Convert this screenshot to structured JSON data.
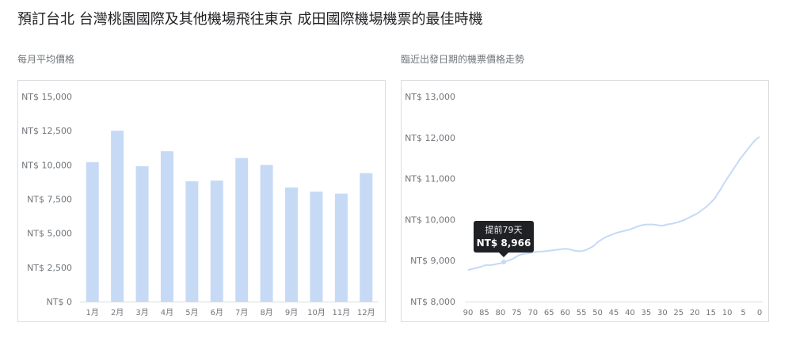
{
  "page": {
    "title": "預訂台北 台灣桃園國際及其他機場飛往東京 成田國際機場機票的最佳時機"
  },
  "colors": {
    "bar": "#c6daf6",
    "line": "#c6daf6",
    "axis": "#dadce0",
    "tooltip_bg": "#202124",
    "marker": "#c6daf6"
  },
  "chart_data": [
    {
      "type": "bar",
      "title": "每月平均價格",
      "categories": [
        "1月",
        "2月",
        "3月",
        "4月",
        "5月",
        "6月",
        "7月",
        "8月",
        "9月",
        "10月",
        "11月",
        "12月"
      ],
      "values": [
        10200,
        12500,
        9900,
        11000,
        8800,
        8850,
        10500,
        10000,
        8350,
        8050,
        7900,
        9400
      ],
      "ylim": [
        0,
        15000
      ],
      "yticks": [
        0,
        2500,
        5000,
        7500,
        10000,
        12500,
        15000
      ],
      "ytick_labels": [
        "NT$ 0",
        "NT$ 2,500",
        "NT$ 5,000",
        "NT$ 7,500",
        "NT$ 10,000",
        "NT$ 12,500",
        "NT$ 15,000"
      ],
      "grid": false
    },
    {
      "type": "line",
      "title": "臨近出發日期的機票價格走勢",
      "x": [
        90,
        89,
        88,
        87,
        86,
        85,
        84,
        83,
        82,
        81,
        80,
        79,
        78,
        77,
        76,
        75,
        74,
        73,
        72,
        71,
        70,
        69,
        68,
        67,
        66,
        65,
        64,
        63,
        62,
        61,
        60,
        59,
        58,
        57,
        56,
        55,
        54,
        53,
        52,
        51,
        50,
        49,
        48,
        47,
        46,
        45,
        44,
        43,
        42,
        41,
        40,
        39,
        38,
        37,
        36,
        35,
        34,
        33,
        32,
        31,
        30,
        29,
        28,
        27,
        26,
        25,
        24,
        23,
        22,
        21,
        20,
        19,
        18,
        17,
        16,
        15,
        14,
        13,
        12,
        11,
        10,
        9,
        8,
        7,
        6,
        5,
        4,
        3,
        2,
        1,
        0
      ],
      "y": [
        8770,
        8790,
        8810,
        8830,
        8850,
        8880,
        8890,
        8890,
        8900,
        8920,
        8930,
        8966,
        8990,
        9020,
        9050,
        9100,
        9140,
        9160,
        9170,
        9180,
        9200,
        9210,
        9220,
        9220,
        9230,
        9240,
        9250,
        9260,
        9270,
        9280,
        9290,
        9280,
        9260,
        9240,
        9230,
        9230,
        9250,
        9280,
        9320,
        9370,
        9450,
        9500,
        9550,
        9590,
        9620,
        9650,
        9680,
        9700,
        9720,
        9740,
        9760,
        9790,
        9820,
        9850,
        9870,
        9880,
        9880,
        9880,
        9870,
        9860,
        9850,
        9870,
        9890,
        9900,
        9920,
        9940,
        9970,
        10000,
        10040,
        10080,
        10120,
        10160,
        10220,
        10280,
        10340,
        10420,
        10500,
        10620,
        10740,
        10880,
        11000,
        11120,
        11240,
        11360,
        11480,
        11580,
        11680,
        11780,
        11880,
        11960,
        12020
      ],
      "xticks": [
        90,
        85,
        80,
        75,
        70,
        65,
        60,
        55,
        50,
        45,
        40,
        35,
        30,
        25,
        20,
        15,
        10,
        5,
        0
      ],
      "xlim": [
        90,
        0
      ],
      "ylim": [
        8000,
        13000
      ],
      "yticks": [
        8000,
        9000,
        10000,
        11000,
        12000,
        13000
      ],
      "ytick_labels": [
        "NT$ 8,000",
        "NT$ 9,000",
        "NT$ 10,000",
        "NT$ 11,000",
        "NT$ 12,000",
        "NT$ 13,000"
      ],
      "grid": false,
      "tooltip": {
        "x": 79,
        "label": "提前79天",
        "value": "NT$ 8,966"
      }
    }
  ]
}
